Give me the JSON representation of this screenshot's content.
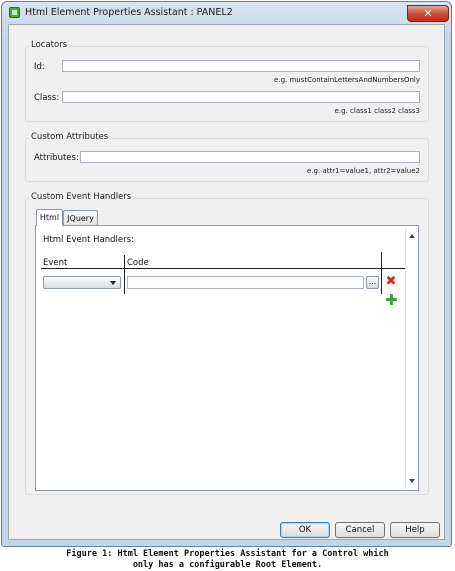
{
  "window": {
    "title": "Html Element Properties Assistant : PANEL2",
    "close_glyph": "✕"
  },
  "locators": {
    "title": "Locators",
    "id_label": "Id:",
    "id_value": "",
    "id_hint": "e.g. mustContainLettersAndNumbersOnly",
    "class_label": "Class:",
    "class_value": "",
    "class_hint": "e.g. class1 class2 class3"
  },
  "custom_attributes": {
    "title": "Custom Attributes",
    "attributes_label": "Attributes:",
    "attributes_value": "",
    "attributes_hint": "e.g. attr1=value1, attr2=value2"
  },
  "event_handlers": {
    "title": "Custom Event Handlers",
    "tabs": [
      {
        "label": "Html",
        "selected": true
      },
      {
        "label": "JQuery",
        "selected": false
      }
    ],
    "section_label": "Html Event Handlers:",
    "columns": [
      "Event",
      "Code"
    ],
    "rows": [
      {
        "event": "",
        "code": ""
      }
    ],
    "ellipsis_label": "...",
    "icons": {
      "delete": "delete-icon",
      "add": "add-icon"
    }
  },
  "buttons": {
    "ok": "OK",
    "cancel": "Cancel",
    "help": "Help"
  },
  "caption": [
    "Figure 1: Html Element Properties Assistant for a Control which",
    "only has a configurable Root Element."
  ]
}
